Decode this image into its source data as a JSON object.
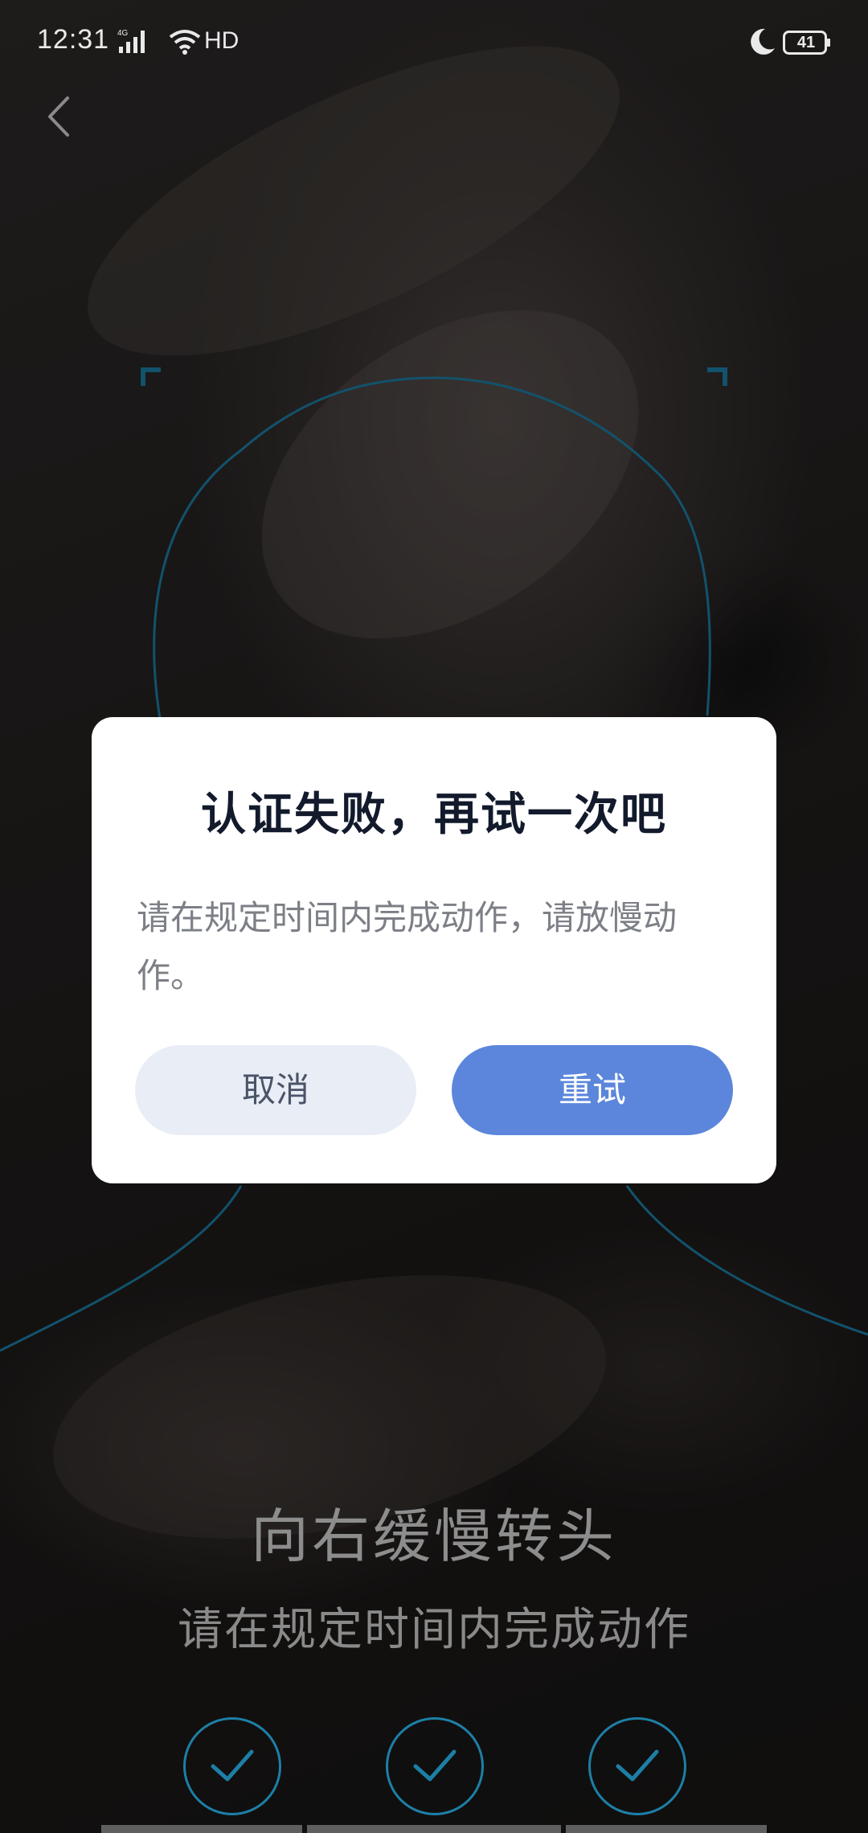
{
  "status_bar": {
    "time": "12:31",
    "network": "4G",
    "hd": "HD",
    "battery": "41"
  },
  "nav": {
    "back_icon": "chevron-left-icon"
  },
  "camera": {
    "guide_color": "#1d7fa6"
  },
  "instruction": {
    "title": "向右缓慢转头",
    "subtitle": "请在规定时间内完成动作"
  },
  "steps": [
    {
      "icon": "check-icon",
      "done": true
    },
    {
      "icon": "check-icon",
      "done": true
    },
    {
      "icon": "check-icon",
      "done": true
    }
  ],
  "dialog": {
    "title": "认证失败，再试一次吧",
    "message": "请在规定时间内完成动作，请放慢动作。",
    "cancel_label": "取消",
    "retry_label": "重试",
    "accent_color": "#5b86db"
  }
}
